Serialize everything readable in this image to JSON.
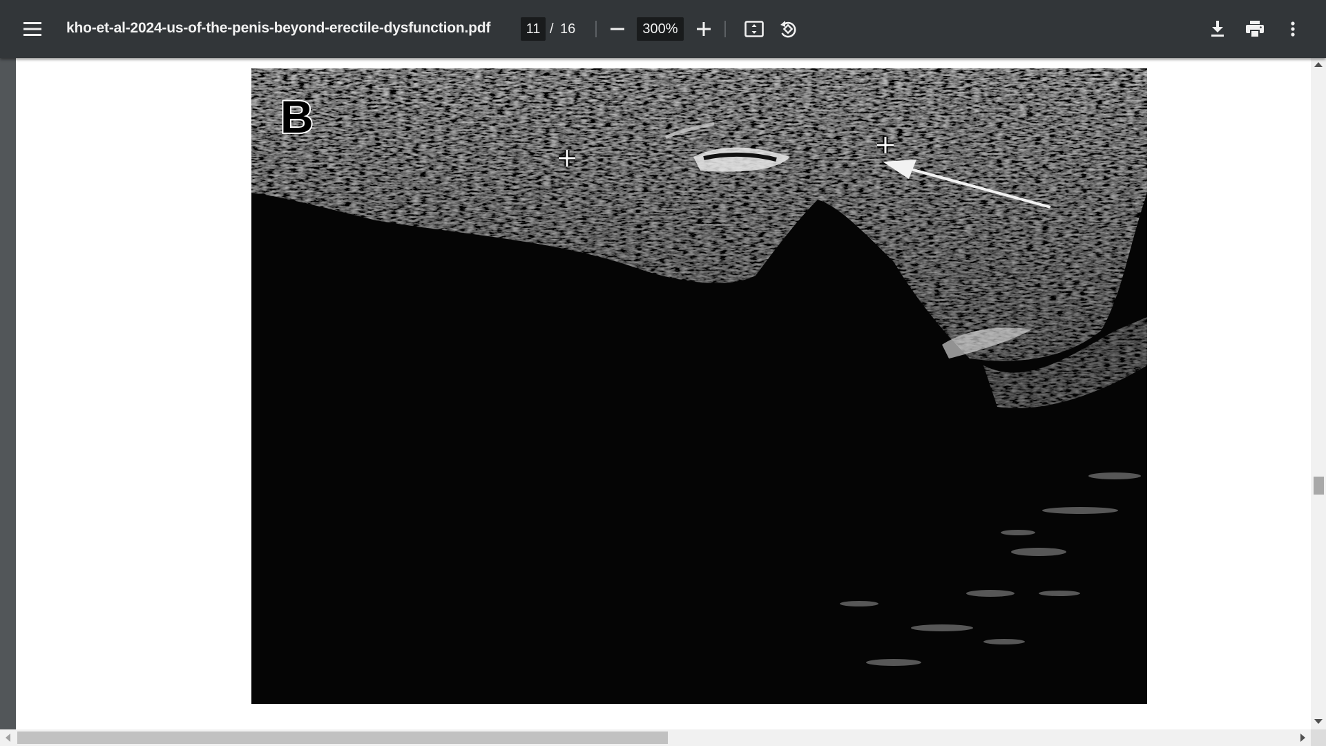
{
  "toolbar": {
    "title": "kho-et-al-2024-us-of-the-penis-beyond-erectile-dysfunction.pdf",
    "current_page": "11",
    "page_separator": "/",
    "total_pages": "16",
    "zoom": "300%",
    "icons": {
      "menu": "hamburger-menu-icon",
      "zoom_out": "minus-icon",
      "zoom_in": "plus-icon",
      "fit": "fit-to-page-icon",
      "rotate": "rotate-counterclockwise-icon",
      "download": "download-icon",
      "print": "printer-icon",
      "more": "vertical-dots-icon"
    }
  },
  "document": {
    "figure_label": "B",
    "figure_type": "grayscale ultrasound image with two caliper cross markers and an arrow"
  },
  "colors": {
    "toolbar_bg": "#323639",
    "viewer_bg": "#525659",
    "page_bg": "#ffffff",
    "input_bg": "#191b1c"
  }
}
